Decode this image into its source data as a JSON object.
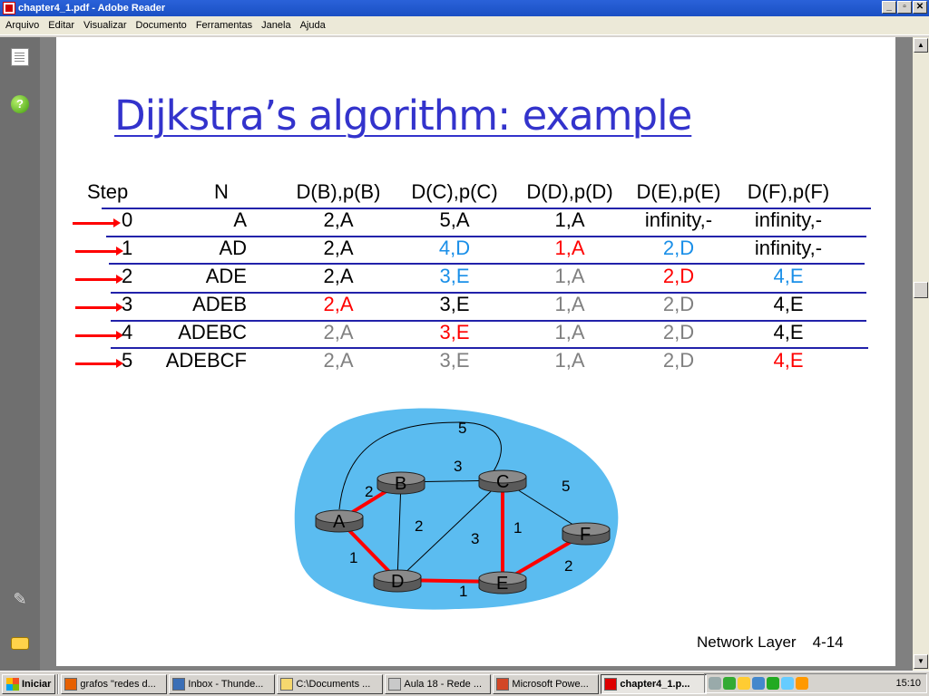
{
  "window": {
    "title": "chapter4_1.pdf - Adobe Reader",
    "btn_min": "_",
    "btn_max": "▫",
    "btn_close": "✕"
  },
  "menu": [
    "Arquivo",
    "Editar",
    "Visualizar",
    "Documento",
    "Ferramentas",
    "Janela",
    "Ajuda"
  ],
  "sidebar": {
    "help_glyph": "?",
    "clip_glyph": "✎"
  },
  "slide": {
    "title": "Dijkstra’s algorithm: example",
    "headers": [
      "Step",
      "N",
      "D(B),p(B)",
      "D(C),p(C)",
      "D(D),p(D)",
      "D(E),p(E)",
      "D(F),p(F)"
    ],
    "rows": [
      {
        "step": "0",
        "n": "A",
        "cells": [
          {
            "t": "2,A",
            "c": "black"
          },
          {
            "t": "5,A",
            "c": "black"
          },
          {
            "t": "1,A",
            "c": "black"
          },
          {
            "t": "infinity,-",
            "c": "black"
          },
          {
            "t": "infinity,-",
            "c": "black"
          }
        ]
      },
      {
        "step": "1",
        "n": "AD",
        "cells": [
          {
            "t": "2,A",
            "c": "black"
          },
          {
            "t": "4,D",
            "c": "blue"
          },
          {
            "t": "1,A",
            "c": "red"
          },
          {
            "t": "2,D",
            "c": "blue"
          },
          {
            "t": "infinity,-",
            "c": "black"
          }
        ]
      },
      {
        "step": "2",
        "n": "ADE",
        "cells": [
          {
            "t": "2,A",
            "c": "black"
          },
          {
            "t": "3,E",
            "c": "blue"
          },
          {
            "t": "1,A",
            "c": "gray"
          },
          {
            "t": "2,D",
            "c": "red"
          },
          {
            "t": "4,E",
            "c": "blue"
          }
        ]
      },
      {
        "step": "3",
        "n": "ADEB",
        "cells": [
          {
            "t": "2,A",
            "c": "red"
          },
          {
            "t": "3,E",
            "c": "black"
          },
          {
            "t": "1,A",
            "c": "gray"
          },
          {
            "t": "2,D",
            "c": "gray"
          },
          {
            "t": "4,E",
            "c": "black"
          }
        ]
      },
      {
        "step": "4",
        "n": "ADEBC",
        "cells": [
          {
            "t": "2,A",
            "c": "gray"
          },
          {
            "t": "3,E",
            "c": "red"
          },
          {
            "t": "1,A",
            "c": "gray"
          },
          {
            "t": "2,D",
            "c": "gray"
          },
          {
            "t": "4,E",
            "c": "black"
          }
        ]
      },
      {
        "step": "5",
        "n": "ADEBCF",
        "cells": [
          {
            "t": "2,A",
            "c": "gray"
          },
          {
            "t": "3,E",
            "c": "gray"
          },
          {
            "t": "1,A",
            "c": "gray"
          },
          {
            "t": "2,D",
            "c": "gray"
          },
          {
            "t": "4,E",
            "c": "red"
          }
        ]
      }
    ],
    "graph": {
      "nodes": [
        "A",
        "B",
        "C",
        "D",
        "E",
        "F"
      ],
      "edges": [
        {
          "from": "A",
          "to": "C",
          "weight": "5",
          "highlight": false
        },
        {
          "from": "A",
          "to": "B",
          "weight": "2",
          "highlight": true
        },
        {
          "from": "B",
          "to": "C",
          "weight": "3",
          "highlight": false
        },
        {
          "from": "C",
          "to": "F",
          "weight": "5",
          "highlight": false
        },
        {
          "from": "B",
          "to": "D",
          "weight": "2",
          "highlight": false
        },
        {
          "from": "D",
          "to": "C",
          "weight": "3",
          "highlight": false
        },
        {
          "from": "C",
          "to": "E",
          "weight": "1",
          "highlight": true
        },
        {
          "from": "A",
          "to": "D",
          "weight": "1",
          "highlight": true
        },
        {
          "from": "D",
          "to": "E",
          "weight": "1",
          "highlight": true
        },
        {
          "from": "E",
          "to": "F",
          "weight": "2",
          "highlight": true
        }
      ]
    },
    "footer": {
      "label": "Network Layer",
      "page": "4-14"
    }
  },
  "colors": {
    "black": "#000000",
    "blue": "#1a8fe8",
    "red": "#ff0000",
    "gray": "#808080",
    "title": "#3333cc",
    "cloud": "#5bbcf0"
  },
  "taskbar": {
    "start": "Iniciar",
    "tasks": [
      {
        "label": "grafos \"redes d...",
        "active": false,
        "icon": "firefox-icon"
      },
      {
        "label": "Inbox - Thunde...",
        "active": false,
        "icon": "thunderbird-icon"
      },
      {
        "label": "C:\\Documents ...",
        "active": false,
        "icon": "folder-icon"
      },
      {
        "label": "Aula 18 - Rede ...",
        "active": false,
        "icon": "document-icon"
      },
      {
        "label": "Microsoft Powe...",
        "active": false,
        "icon": "powerpoint-icon"
      },
      {
        "label": "chapter4_1.p...",
        "active": true,
        "icon": "pdf-icon"
      }
    ],
    "clock": "15:10"
  }
}
